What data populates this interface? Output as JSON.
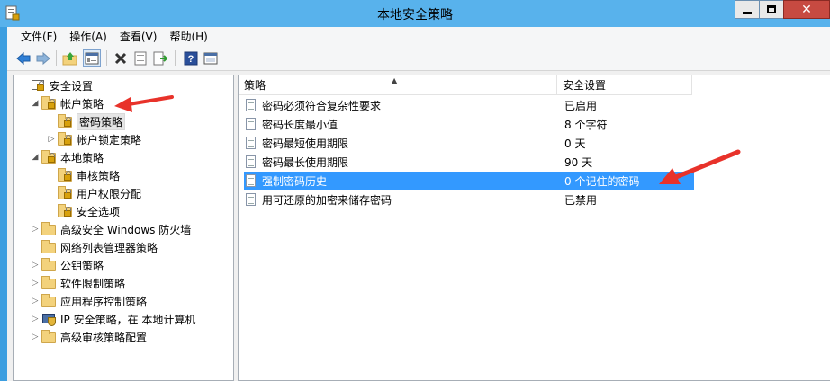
{
  "window": {
    "title": "本地安全策略"
  },
  "menu": [
    "文件(F)",
    "操作(A)",
    "查看(V)",
    "帮助(H)"
  ],
  "toolbar_icons": [
    "back-icon",
    "forward-icon",
    "up-folder-icon",
    "show-tree-icon",
    "delete-icon",
    "properties-icon",
    "export-list-icon",
    "help-icon",
    "console-icon"
  ],
  "tree": [
    {
      "label": "安全设置",
      "icon": "security-settings-icon",
      "depth": 0,
      "expander": ""
    },
    {
      "label": "帐户策略",
      "icon": "locked-folder-icon",
      "depth": 1,
      "expander": "◢"
    },
    {
      "label": "密码策略",
      "icon": "locked-folder-icon",
      "depth": 2,
      "expander": "",
      "selected": true
    },
    {
      "label": "帐户锁定策略",
      "icon": "locked-folder-icon",
      "depth": 2,
      "expander": "▷"
    },
    {
      "label": "本地策略",
      "icon": "locked-folder-icon",
      "depth": 1,
      "expander": "◢"
    },
    {
      "label": "审核策略",
      "icon": "locked-folder-icon",
      "depth": 2,
      "expander": ""
    },
    {
      "label": "用户权限分配",
      "icon": "locked-folder-icon",
      "depth": 2,
      "expander": ""
    },
    {
      "label": "安全选项",
      "icon": "locked-folder-icon",
      "depth": 2,
      "expander": ""
    },
    {
      "label": "高级安全 Windows 防火墙",
      "icon": "folder-icon",
      "depth": 1,
      "expander": "▷"
    },
    {
      "label": "网络列表管理器策略",
      "icon": "folder-icon",
      "depth": 1,
      "expander": ""
    },
    {
      "label": "公钥策略",
      "icon": "folder-icon",
      "depth": 1,
      "expander": "▷"
    },
    {
      "label": "软件限制策略",
      "icon": "folder-icon",
      "depth": 1,
      "expander": "▷"
    },
    {
      "label": "应用程序控制策略",
      "icon": "folder-icon",
      "depth": 1,
      "expander": "▷"
    },
    {
      "label": "IP 安全策略，在 本地计算机",
      "icon": "ip-security-icon",
      "depth": 1,
      "expander": "▷"
    },
    {
      "label": "高级审核策略配置",
      "icon": "folder-icon",
      "depth": 1,
      "expander": "▷"
    }
  ],
  "columns": {
    "policy": "策略",
    "setting": "安全设置"
  },
  "policies": [
    {
      "name": "密码必须符合复杂性要求",
      "value": "已启用"
    },
    {
      "name": "密码长度最小值",
      "value": "8 个字符"
    },
    {
      "name": "密码最短使用期限",
      "value": "0 天"
    },
    {
      "name": "密码最长使用期限",
      "value": "90 天"
    },
    {
      "name": "强制密码历史",
      "value": "0 个记住的密码",
      "selected": true
    },
    {
      "name": "用可还原的加密来储存密码",
      "value": "已禁用"
    }
  ],
  "colors": {
    "titlebar": "#58b2ec",
    "frame": "#3c9ee0",
    "selection": "#3399ff",
    "annotation_arrow": "#e8322a"
  }
}
